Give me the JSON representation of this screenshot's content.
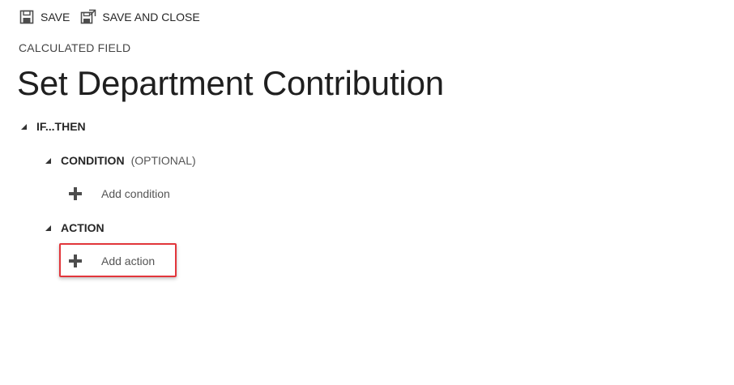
{
  "toolbar": {
    "save_label": "SAVE",
    "save_close_label": "SAVE AND CLOSE",
    "save_icon": "save-icon",
    "save_close_icon": "save-and-close-icon"
  },
  "header": {
    "entity_label": "CALCULATED FIELD",
    "title": "Set Department Contribution"
  },
  "tree": {
    "root": {
      "label": "IF...THEN",
      "condition": {
        "label": "CONDITION",
        "sub_label": "(OPTIONAL)",
        "add_label": "Add condition"
      },
      "action": {
        "label": "ACTION",
        "add_label": "Add action"
      }
    }
  },
  "colors": {
    "highlight_border": "#e2363b",
    "text": "#262626",
    "muted_text": "#555555"
  }
}
